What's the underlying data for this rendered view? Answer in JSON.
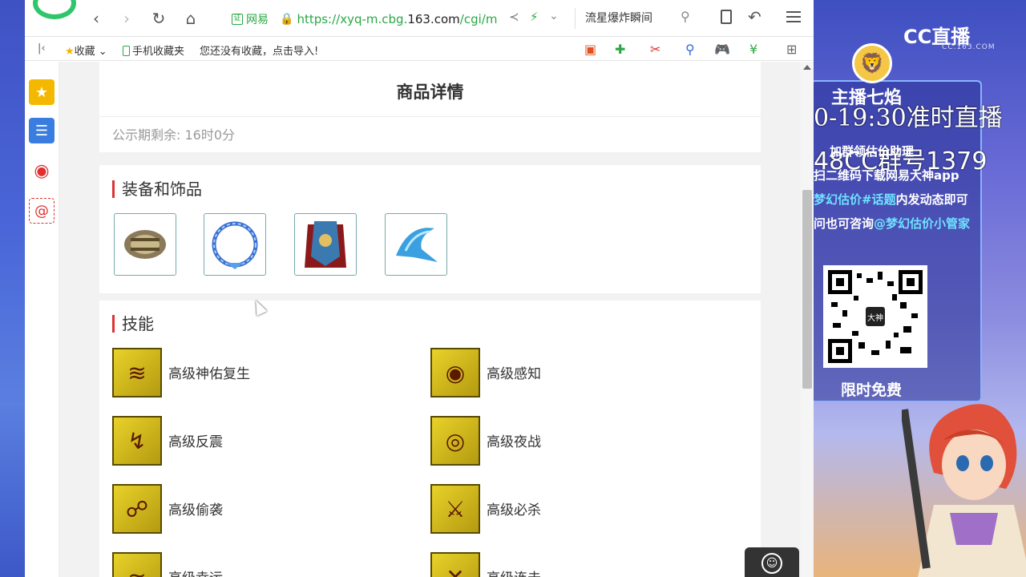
{
  "browser": {
    "address": {
      "cert_badge": "证",
      "site_label": "网易",
      "url_prefix": "https://xyq-m.cbg.",
      "url_domain": "163.com",
      "url_suffix": "/cgi/m"
    },
    "search_text": "流星爆炸瞬间"
  },
  "bookmarks": {
    "favorites": "收藏",
    "mobile": "手机收藏夹",
    "empty_hint": "您还没有收藏，点击导入!"
  },
  "page": {
    "detail_title": "商品详情",
    "public_time": "公示期剩余: 16时0分",
    "equip_section": "装备和饰品",
    "skill_section": "技能",
    "skills": [
      {
        "name": "高级神佑复生",
        "glyph": "≋"
      },
      {
        "name": "高级感知",
        "glyph": "◉"
      },
      {
        "name": "高级反震",
        "glyph": "↯"
      },
      {
        "name": "高级夜战",
        "glyph": "◎"
      },
      {
        "name": "高级偷袭",
        "glyph": "☍"
      },
      {
        "name": "高级必杀",
        "glyph": "⚔"
      },
      {
        "name": "高级幸运",
        "glyph": "≈"
      },
      {
        "name": "高级连击",
        "glyph": "✕"
      }
    ]
  },
  "overlay": {
    "cc_logo": "CC直播",
    "cc_sub": "CC.163.COM",
    "host_name": "主播七焰",
    "schedule": "0-19:30准时直播",
    "group": "48CC群号1379",
    "line1": "加群领估价助理",
    "line2": "扫二维码下载网易大神app",
    "line3_hl": "梦幻估价#话题",
    "line3_rest": "内发动态即可",
    "line4_pre": "问也可咨询",
    "line4_hl": "@梦幻估价小管家",
    "qr_center": "大神",
    "free": "限时免费"
  }
}
